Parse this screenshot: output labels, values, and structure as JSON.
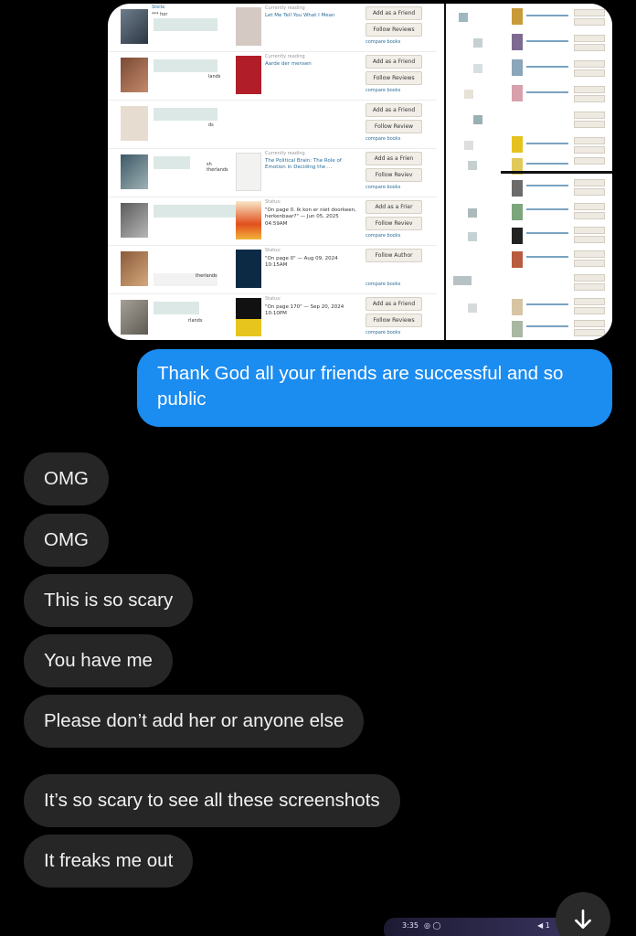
{
  "screenshot": {
    "rows": [
      {
        "name": "Stella",
        "name2": "*** hor",
        "location": "",
        "status_label": "Currently reading",
        "book": "Let Me Tell You What I Mean",
        "status": "",
        "btn1": "Add as a Friend",
        "btn2": "Follow Reviews",
        "compare": "compare books"
      },
      {
        "name": "",
        "name2": "",
        "location": "lands",
        "status_label": "Currently reading",
        "book": "Aarde der mensen",
        "status": "",
        "btn1": "Add as a Friend",
        "btn2": "Follow Reviews",
        "compare": "compare books"
      },
      {
        "name": "",
        "name2": "",
        "location": "ds",
        "status_label": "",
        "book": "",
        "status": "",
        "btn1": "Add as a Friend",
        "btn2": "Follow Review",
        "compare": "compare books"
      },
      {
        "name": "",
        "name2": "",
        "location": "sh therlands",
        "status_label": "Currently reading",
        "book": "The Political Brain: The Role of Emotion in Deciding the ...",
        "status": "",
        "btn1": "Add as a Frien",
        "btn2": "Follow Reviev",
        "compare": "compare books"
      },
      {
        "name": "",
        "name2": "",
        "location": "",
        "status_label": "Status:",
        "book": "",
        "status": "\"On page 0. Ik kon er niet doorkeen, herkenbaar?\" — Jun 05, 2025 04:59AM",
        "btn1": "Add as a Frier",
        "btn2": "Follow Reviev",
        "compare": "compare books"
      },
      {
        "name": "",
        "name2": "",
        "location": "therlands",
        "status_label": "Status:",
        "book": "",
        "status": "\"On page 0\" — Aug 09, 2024 10:15AM",
        "btn1": "Follow Author",
        "btn2": "",
        "compare": "compare books"
      },
      {
        "name": "",
        "name2": "",
        "location": "rlands",
        "status_label": "Status:",
        "book": "",
        "status": "\"On page 170\" — Sep 20, 2024 10:10PM",
        "btn1": "Add as a Friend",
        "btn2": "Follow Reviews",
        "compare": "compare books"
      }
    ]
  },
  "sent_message": "Thank God all your friends are successful and so public",
  "received_messages": [
    "OMG",
    "OMG",
    "This is so scary",
    "You have me",
    "Please don’t add her or anyone else",
    "It’s so scary to see all these screenshots",
    "It freaks me out"
  ],
  "bottom": {
    "time": "3:35",
    "status_icons": "◎ ◯",
    "status_right": "◀ 1",
    "scroll_icon": "arrow-down-icon"
  },
  "colors": {
    "sent_bubble": "#1b8cf0",
    "received_bubble": "#262626",
    "background": "#000000"
  }
}
